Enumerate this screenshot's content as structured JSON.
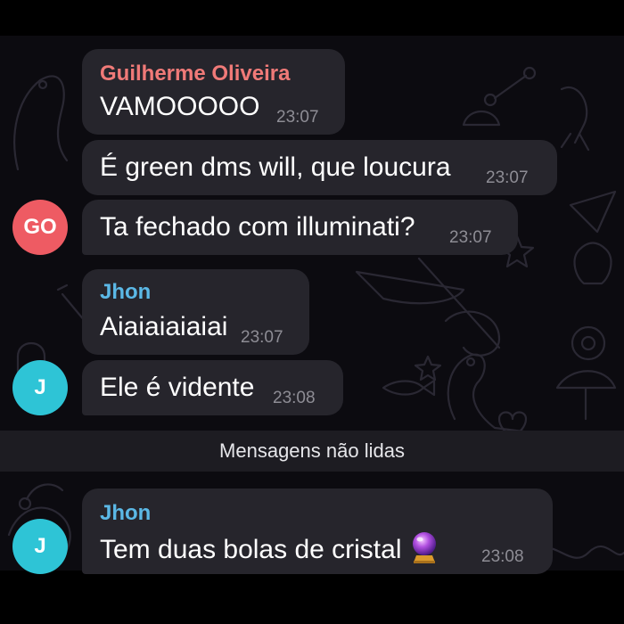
{
  "messages": [
    {
      "sender": "Guilherme Oliveira",
      "text": "VAMOOOOO",
      "time": "23:07"
    },
    {
      "text": "É green dms will, que loucura",
      "time": "23:07"
    },
    {
      "text": "Ta fechado com illuminati?",
      "time": "23:07"
    },
    {
      "sender": "Jhon",
      "text": "Aiaiaiaiaiai",
      "time": "23:07"
    },
    {
      "text": "Ele é vidente",
      "time": "23:08"
    },
    {
      "sender": "Jhon",
      "text": "Tem duas bolas de cristal",
      "emoji": "crystal-ball-icon",
      "time": "23:08"
    }
  ],
  "avatars": [
    {
      "initials": "GO",
      "color": "#ee5b63"
    },
    {
      "initials": "J",
      "color": "#2ec4d6"
    },
    {
      "initials": "J",
      "color": "#2ec4d6"
    }
  ],
  "divider_label": "Mensagens não lidas",
  "colors": {
    "bubble": "#26252c",
    "sender_guilherme": "#f07a78",
    "sender_jhon": "#5bb8e6",
    "timestamp": "#8e8d95",
    "background": "#0c0b10"
  }
}
